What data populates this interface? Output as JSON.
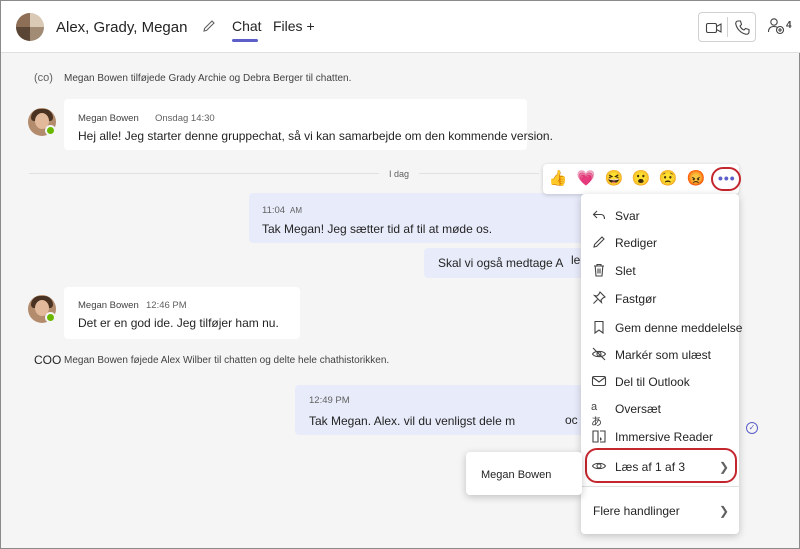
{
  "header": {
    "title": "Alex, Grady, Megan",
    "tabs": [
      {
        "label": "Chat",
        "active": true
      },
      {
        "label": "Files +"
      }
    ],
    "people_count": "4",
    "icons": [
      "group-avatar",
      "pencil-icon",
      "video-icon",
      "phone-icon",
      "people-add-icon"
    ]
  },
  "system_messages": [
    {
      "icon": "(co)",
      "text": "Megan Bowen tilføjede Grady Archie og Debra Berger til chatten."
    },
    {
      "icon": "COO",
      "text": "Megan Bowen føjede Alex Wilber til chatten og delte hele chathistorikken."
    }
  ],
  "messages": {
    "m1": {
      "sender": "Megan Bowen",
      "time": "Onsdag 14:30",
      "text": "Hej alle! Jeg starter denne gruppechat, så vi kan samarbejde om den kommende version."
    },
    "day_divider": "I dag",
    "m2": {
      "time": "11:04",
      "ampm": "AM",
      "text": "Tak Megan! Jeg sætter tid af til at møde os."
    },
    "m3": {
      "text": "Skal vi også medtage A",
      "tail": "le"
    },
    "m4": {
      "sender": "Megan Bowen",
      "time": "12:46 PM",
      "text": "Det er en god ide. Jeg tilføjer ham nu."
    },
    "m5": {
      "time": "12:49 PM",
      "text": "Tak Megan. Alex. vil du venligst dele m",
      "tail": "oc"
    }
  },
  "reactions": [
    "👍",
    "💗",
    "😆",
    "😮",
    "😟",
    "😡"
  ],
  "more_options_label": "•••",
  "menu": {
    "items": [
      {
        "label": "Svar",
        "icon": "reply-icon"
      },
      {
        "label": "Rediger",
        "icon": "edit-icon"
      },
      {
        "label": "Slet",
        "icon": "delete-icon"
      },
      {
        "label": "Fastgør",
        "icon": "pin-icon"
      },
      {
        "label": "Gem denne meddelelse",
        "icon": "bookmark-icon"
      },
      {
        "label": "Markér som ulæst",
        "icon": "unread-icon"
      },
      {
        "label": "Del til Outlook",
        "icon": "mail-icon"
      },
      {
        "label": "Oversæt",
        "icon": "translate-icon"
      },
      {
        "label": "Immersive Reader",
        "icon": "reader-icon"
      },
      {
        "label": "Læs af 1 af 3",
        "icon": "eye-icon"
      },
      {
        "label": "Flere handlinger",
        "icon": ""
      }
    ]
  },
  "submenu": {
    "name": "Megan Bowen"
  },
  "colors": {
    "accent": "#5b5fc7",
    "highlight": "#c4262e",
    "outgoing_bubble": "#e8ebfa"
  }
}
